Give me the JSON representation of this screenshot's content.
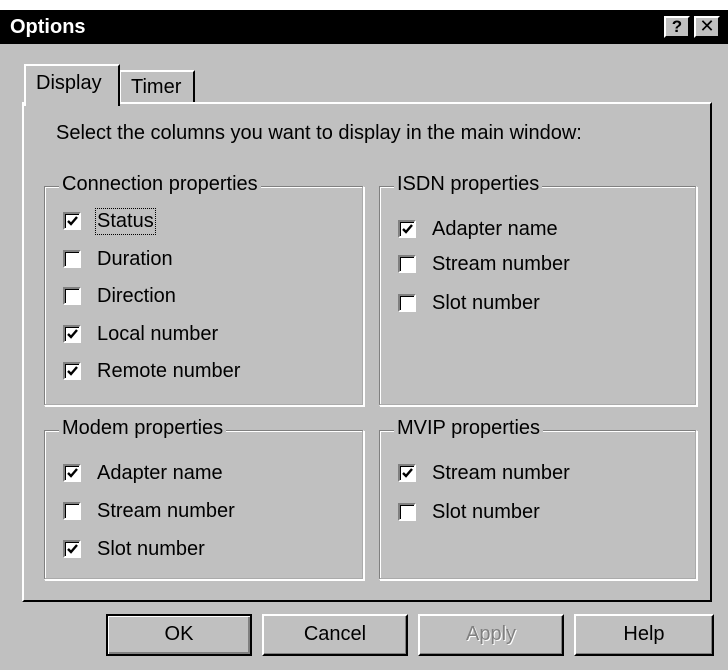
{
  "window": {
    "title": "Options",
    "help_glyph": "?",
    "close_glyph": "✕"
  },
  "tabs": [
    {
      "label": "Display",
      "selected": true
    },
    {
      "label": "Timer",
      "selected": false
    }
  ],
  "instruction": "Select the columns you want to display in the main window:",
  "groups": {
    "connection": {
      "title": "Connection properties",
      "items": [
        {
          "label": "Status",
          "checked": true
        },
        {
          "label": "Duration",
          "checked": false
        },
        {
          "label": "Direction",
          "checked": false
        },
        {
          "label": "Local number",
          "checked": true
        },
        {
          "label": "Remote number",
          "checked": true
        }
      ]
    },
    "isdn": {
      "title": "ISDN properties",
      "items": [
        {
          "label": "Adapter name",
          "checked": true
        },
        {
          "label": "Stream number",
          "checked": false
        },
        {
          "label": "Slot number",
          "checked": false
        }
      ]
    },
    "modem": {
      "title": "Modem properties",
      "items": [
        {
          "label": "Adapter name",
          "checked": true
        },
        {
          "label": "Stream number",
          "checked": false
        },
        {
          "label": "Slot number",
          "checked": true
        }
      ]
    },
    "mvip": {
      "title": "MVIP properties",
      "items": [
        {
          "label": "Stream number",
          "checked": true
        },
        {
          "label": "Slot number",
          "checked": false
        }
      ]
    }
  },
  "buttons": {
    "ok": "OK",
    "cancel": "Cancel",
    "apply": "Apply",
    "help": "Help"
  },
  "icons": {
    "checkmark": "check-icon"
  }
}
